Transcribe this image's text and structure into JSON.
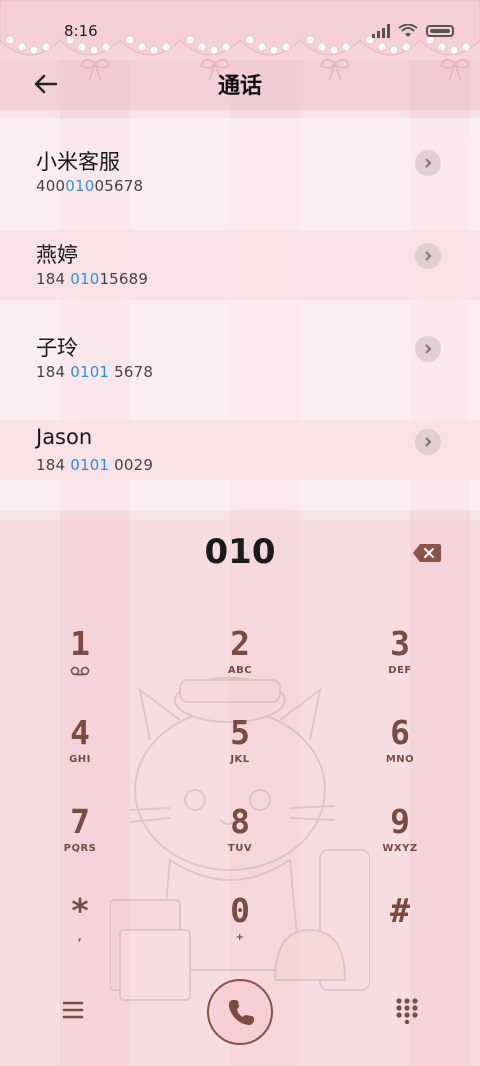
{
  "status": {
    "time": "8:16"
  },
  "header": {
    "title": "通话"
  },
  "contacts": [
    {
      "name": "小米客服",
      "number_pre": "400",
      "number_hl": "010",
      "number_post": "05678"
    },
    {
      "name": "燕婷",
      "number_pre": "184 ",
      "number_hl": "010",
      "number_post": "15689"
    },
    {
      "name": "子玲",
      "number_pre": "184 ",
      "number_hl": "0101",
      "number_post": " 5678"
    },
    {
      "name": "Jason",
      "number_pre": "184 ",
      "number_hl": "0101",
      "number_post": " 0029"
    }
  ],
  "dialer": {
    "input": "010",
    "keys": [
      {
        "digit": "1",
        "letters": ""
      },
      {
        "digit": "2",
        "letters": "ABC"
      },
      {
        "digit": "3",
        "letters": "DEF"
      },
      {
        "digit": "4",
        "letters": "GHI"
      },
      {
        "digit": "5",
        "letters": "JKL"
      },
      {
        "digit": "6",
        "letters": "MNO"
      },
      {
        "digit": "7",
        "letters": "PQRS"
      },
      {
        "digit": "8",
        "letters": "TUV"
      },
      {
        "digit": "9",
        "letters": "WXYZ"
      },
      {
        "digit": "*",
        "letters": ","
      },
      {
        "digit": "0",
        "letters": "+"
      },
      {
        "digit": "#",
        "letters": ""
      }
    ]
  },
  "icons": {
    "back": "back-arrow-icon",
    "chevron": "chevron-right-icon",
    "backspace": "backspace-icon",
    "voicemail": "voicemail-icon",
    "menu": "menu-icon",
    "call": "phone-icon",
    "dialpad": "dialpad-icon"
  },
  "colors": {
    "accent": "#7b4b42",
    "highlight": "#2f8dd6",
    "background": "#f6dde2"
  }
}
